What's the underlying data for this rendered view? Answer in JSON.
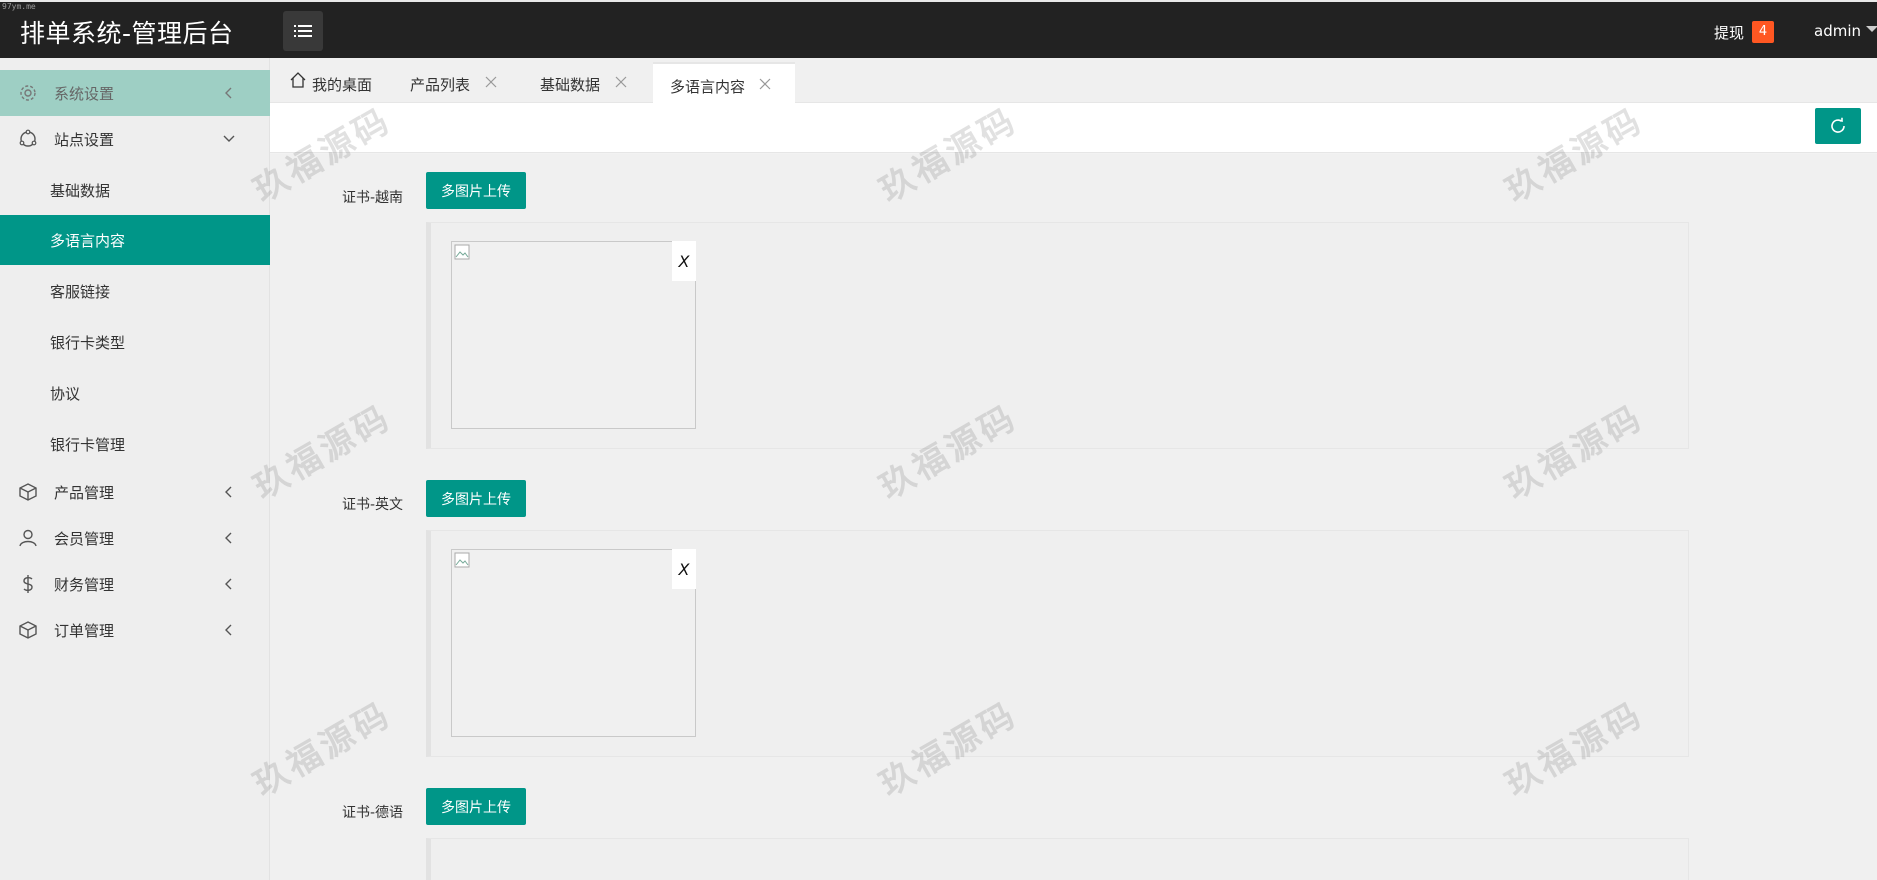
{
  "header": {
    "corner_mark": "97ym.me",
    "title": "排单系统-管理后台",
    "withdraw_label": "提现",
    "withdraw_count": "4",
    "user": "admin"
  },
  "sidebar": {
    "items": [
      {
        "label": "系统设置",
        "icon": "gear-icon",
        "state": "collapsed"
      },
      {
        "label": "站点设置",
        "icon": "site-icon",
        "state": "expanded"
      },
      {
        "label": "产品管理",
        "icon": "box-icon",
        "state": "collapsed"
      },
      {
        "label": "会员管理",
        "icon": "user-icon",
        "state": "collapsed"
      },
      {
        "label": "财务管理",
        "icon": "dollar-icon",
        "state": "collapsed"
      },
      {
        "label": "订单管理",
        "icon": "order-box-icon",
        "state": "collapsed"
      }
    ],
    "sub_items": [
      {
        "label": "基础数据"
      },
      {
        "label": "多语言内容",
        "current": true
      },
      {
        "label": "客服链接"
      },
      {
        "label": "银行卡类型"
      },
      {
        "label": "协议"
      },
      {
        "label": "银行卡管理"
      }
    ]
  },
  "tabs": [
    {
      "label": "我的桌面",
      "icon": "home-icon"
    },
    {
      "label": "产品列表",
      "closable": true
    },
    {
      "label": "基础数据",
      "closable": true
    },
    {
      "label": "多语言内容",
      "closable": true,
      "active": true
    }
  ],
  "toolbar": {
    "refresh_icon": "refresh-icon"
  },
  "sections": [
    {
      "label": "证书-越南",
      "button": "多图片上传",
      "delete": "X"
    },
    {
      "label": "证书-英文",
      "button": "多图片上传",
      "delete": "X"
    },
    {
      "label": "证书-德语",
      "button": "多图片上传"
    }
  ],
  "watermark": "玖福源码",
  "colors": {
    "topbar": "#222222",
    "accent": "#009688",
    "sidebar_active_top": "#9ecfc4",
    "badge": "#ff5722"
  }
}
